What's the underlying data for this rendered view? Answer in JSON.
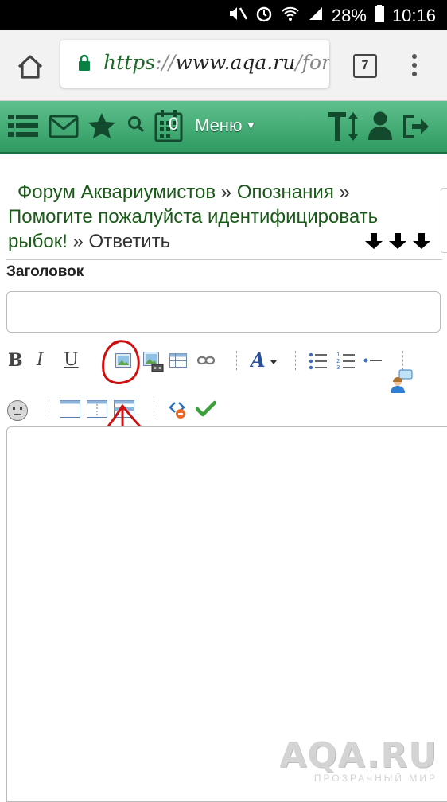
{
  "status_bar": {
    "battery": "28%",
    "time": "10:16"
  },
  "browser": {
    "url_scheme": "https",
    "url_separator": "://",
    "url_host": "www.aqa.ru",
    "url_path": "/forur",
    "tab_count": "7"
  },
  "site_nav": {
    "notif_count": "0",
    "menu_label": "Меню"
  },
  "breadcrumb": {
    "forum": "Форум Аквариумистов",
    "sep1": " » ",
    "section": "Опознания",
    "sep2": " » ",
    "topic": "Помогите пожалуйста идентифицировать рыбок!",
    "sep3": " » ",
    "current": "Ответить"
  },
  "form": {
    "subject_label": "Заголовок",
    "subject_value": "",
    "body_value": ""
  },
  "toolbar": {
    "bold": "B",
    "italic": "I",
    "underline": "U"
  },
  "watermark": {
    "main": "AQA.RU",
    "sub": "ПРОЗРАЧНЫЙ МИР"
  },
  "colors": {
    "nav_green": "#2e9a61",
    "link_green": "#1a5a18",
    "annotation_red": "#d01010"
  }
}
